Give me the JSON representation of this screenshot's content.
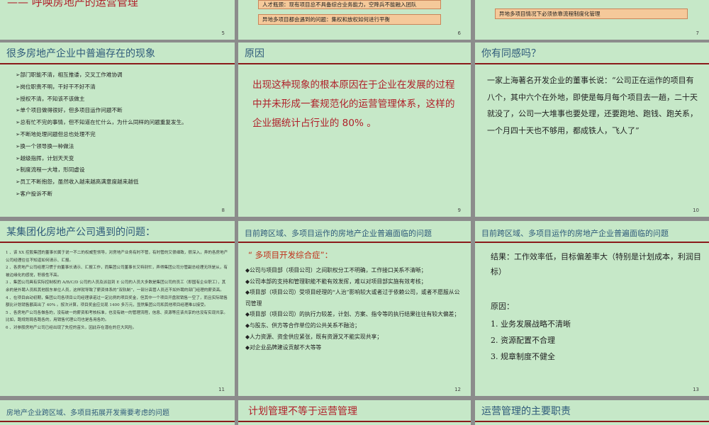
{
  "row0": {
    "s5": {
      "title": "—— 呼唤房地产的运营管理",
      "page": "5"
    },
    "s6": {
      "boxes": [
        "人才瓶颈：现有项目总不具备综合业务能力，空降兵不能融入团队",
        "异地多项目都会遇到的问题：集权和放权如何进行平衡"
      ],
      "page": "6"
    },
    "s7": {
      "boxes": [
        "异地多项目情况下必须依靠流程制度化管理"
      ],
      "page": "7"
    }
  },
  "row1": {
    "s8": {
      "title": "很多房地产企业中普遍存在的现象",
      "items": [
        "➢部门职能不清，相互推诿，交叉工作难协调",
        "➢岗位职责不明，干好干不好不清",
        "➢授权不清，不知该不该做主",
        "➢单个项目做得很好，但多项目运作问题不断",
        "➢总有忙不完的事情，但不知道在忙什么，为什么同样的问题重复发生。",
        "➢不断地处理问题但总也处理不完",
        "➢换一个领导换一种做法",
        "➢越级指挥，计划天天变",
        "➢制度流程一大堆，形同虚设",
        "➢员工不断抱怨，虽然收入越来越高满意度越来越低",
        "➢客户投诉不断"
      ],
      "page": "8"
    },
    "s9": {
      "title": "原因",
      "text": "出现这种现象的根本原因在于企业在发展的过程中并未形成一套规范化的运营管理体系，这样的企业据统计占行业的 80% 。",
      "page": "9"
    },
    "s10": {
      "title": "你有同感吗？",
      "text": "一家上海著名开发企业的董事长说：“公司正在运作的项目有八个，其中六个在外地，即使是每月每个项目去一趟，二十天就没了，公司一大堆事也要处理，还要跑地、跑钱、跑关系，一个月四十天也不够用，都成铁人，飞人了”",
      "page": "10"
    }
  },
  "row2": {
    "s11": {
      "title": "某集团化房地产公司遇到的问题：",
      "items": [
        "1 、该 XX 控股集团的董事长属于说一不二的权威型领导，对房地产业务有时不管，有时管的又很细致，很深入，弄的各房地产公司经理往往不知道如何请示、汇报。",
        "2 、各房地产公司经理习惯于向董事长请示、汇报工作，而集团公司董事长又特别忙，弄得集团公司分管副总经理无所是从，有被边缘化的感觉，积极性不高。",
        "3 、集团公司具有实际控制权的 A/B/C/D 公司的人员及派驻到 E 公司的人员大多数是集团公司的员工（即国有企业职工），其余的是外聘人员和其他股东单位人员，这样就导致了薪资体系的“双轨制”，一部分高管人员还不如外聘的部门经理的薪资高。",
        "4 、在项目启动初期，集团公司各项目公司经理承诺过一定比例的项目奖金，但其中一个项目开盘就销售一空了，而且实际销售额比计划销售额高出了 40% 。按次计算，项目奖金应兑现 1400 多万元，显然集团公司和其他项目经理难以接受。",
        "5 、各房地产公司各做各的，没有统一的薪资和考核标准，也没有统一的管理流程，信息、资源等应该共享的也没有实现共享。比如，跑规划局各跑各的，用销售代理公司也是各用各的。",
        "6 、对参股房地产公司已经出现了失控的苗头，因此存在潜在的巨大风险。"
      ],
      "page": "11"
    },
    "s12": {
      "title": "目前跨区域、多项目运作的房地产企业普遍面临的问题",
      "syndrome": "“ 多项目开发综合症”：",
      "items": [
        "◆公司与项目部（项目公司）之间职权分工不明确，工作接口关系不清晰；",
        "◆公司本部的支持和管理职能不能有效发挥，难以对项目部实施有效考核；",
        "◆项目部（项目公司）受项目经理的“人治”影响较大或者过于依赖公司，或者不愿服从公司管理",
        "◆项目部（项目公司）的执行力较差，计划、方案、指令等的执行结果往往有较大偏差；",
        "◆与股东、供方等合作单位的公共关系不融洽；",
        "◆人力资源、资金供应紧张，既有资源又不能实现共享；",
        "◆对企业品牌建设贡献不大等等"
      ],
      "page": "12"
    },
    "s13": {
      "title": "目前跨区域、多项目运作的房地产企业普遍面临的问题",
      "result": "结果：工作效率低，目标偏差率大（特别是计划成本，利润目标）",
      "reason_head": "原因：",
      "reasons": [
        "1.  业务发展战略不清晰",
        "2.  资源配置不合理",
        "3.  规章制度不健全"
      ],
      "page": "13"
    }
  },
  "row3": {
    "s14": {
      "title": "房地产企业跨区域、多项目拓展开发需要考虑的问题"
    },
    "s15": {
      "title": "计划管理不等于运营管理"
    },
    "s16": {
      "title": "运营管理的主要职责"
    }
  }
}
